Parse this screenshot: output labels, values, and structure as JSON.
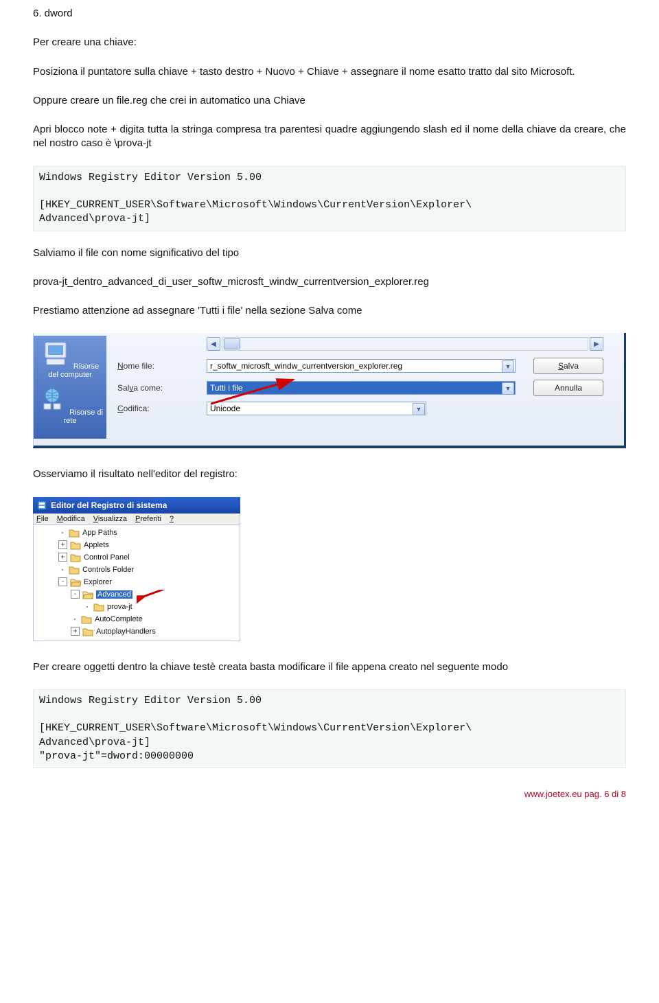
{
  "p_dword": "6. dword",
  "p_create_key": "Per creare una chiave:",
  "p_instructions_chiave": "Posiziona il puntatore sulla chiave + tasto destro + Nuovo + Chiave + assegnare il nome esatto tratto dal sito Microsoft.",
  "p_oppure": "Oppure creare un file.reg che crei in automatico una Chiave",
  "p_apri_blocco": "Apri blocco note + digita tutta la stringa compresa tra parentesi quadre aggiungendo slash ed il nome della chiave da creare, che nel nostro caso è \\prova-jt",
  "code1": "Windows Registry Editor Version 5.00\n\n[HKEY_CURRENT_USER\\Software\\Microsoft\\Windows\\CurrentVersion\\Explorer\\\nAdvanced\\prova-jt]",
  "p_salviamo": "Salviamo il file con nome significativo del tipo",
  "p_filename": "prova-jt_dentro_advanced_di_user_softw_microsft_windw_currentversion_explorer.reg",
  "p_prestiamo": "Prestiamo attenzione ad assegnare 'Tutti i file' nella sezione Salva come",
  "p_osserviamo": "Osserviamo il risultato nell'editor del registro:",
  "p_per_creare_oggetti": "Per creare oggetti dentro la chiave testè creata basta modificare il file appena creato nel seguente modo",
  "code2": "Windows Registry Editor Version 5.00\n\n[HKEY_CURRENT_USER\\Software\\Microsoft\\Windows\\CurrentVersion\\Explorer\\\nAdvanced\\prova-jt]\n\"prova-jt\"=dword:00000000",
  "footer": "www.joetex.eu pag. 6 di 8",
  "dialog": {
    "places": {
      "computer": "Risorse del computer",
      "network": "Risorse di rete"
    },
    "labels": {
      "nome_file": "Nome file:",
      "salva_come": "Salva come:",
      "codifica": "Codifica:"
    },
    "values": {
      "nome_file": "r_softw_microsft_windw_currentversion_explorer.reg",
      "salva_come": "Tutti i file",
      "codifica": "Unicode"
    },
    "buttons": {
      "salva": "Salva",
      "annulla": "Annulla"
    }
  },
  "regedit": {
    "title": "Editor del Registro di sistema",
    "menu": {
      "file": "File",
      "modifica": "Modifica",
      "visualizza": "Visualizza",
      "preferiti": "Preferiti",
      "help": "?"
    },
    "tree": {
      "n0": "App Paths",
      "n1": "Applets",
      "n2": "Control Panel",
      "n3": "Controls Folder",
      "n4": "Explorer",
      "n5": "Advanced",
      "n6": "prova-jt",
      "n7": "AutoComplete",
      "n8": "AutoplayHandlers"
    }
  }
}
